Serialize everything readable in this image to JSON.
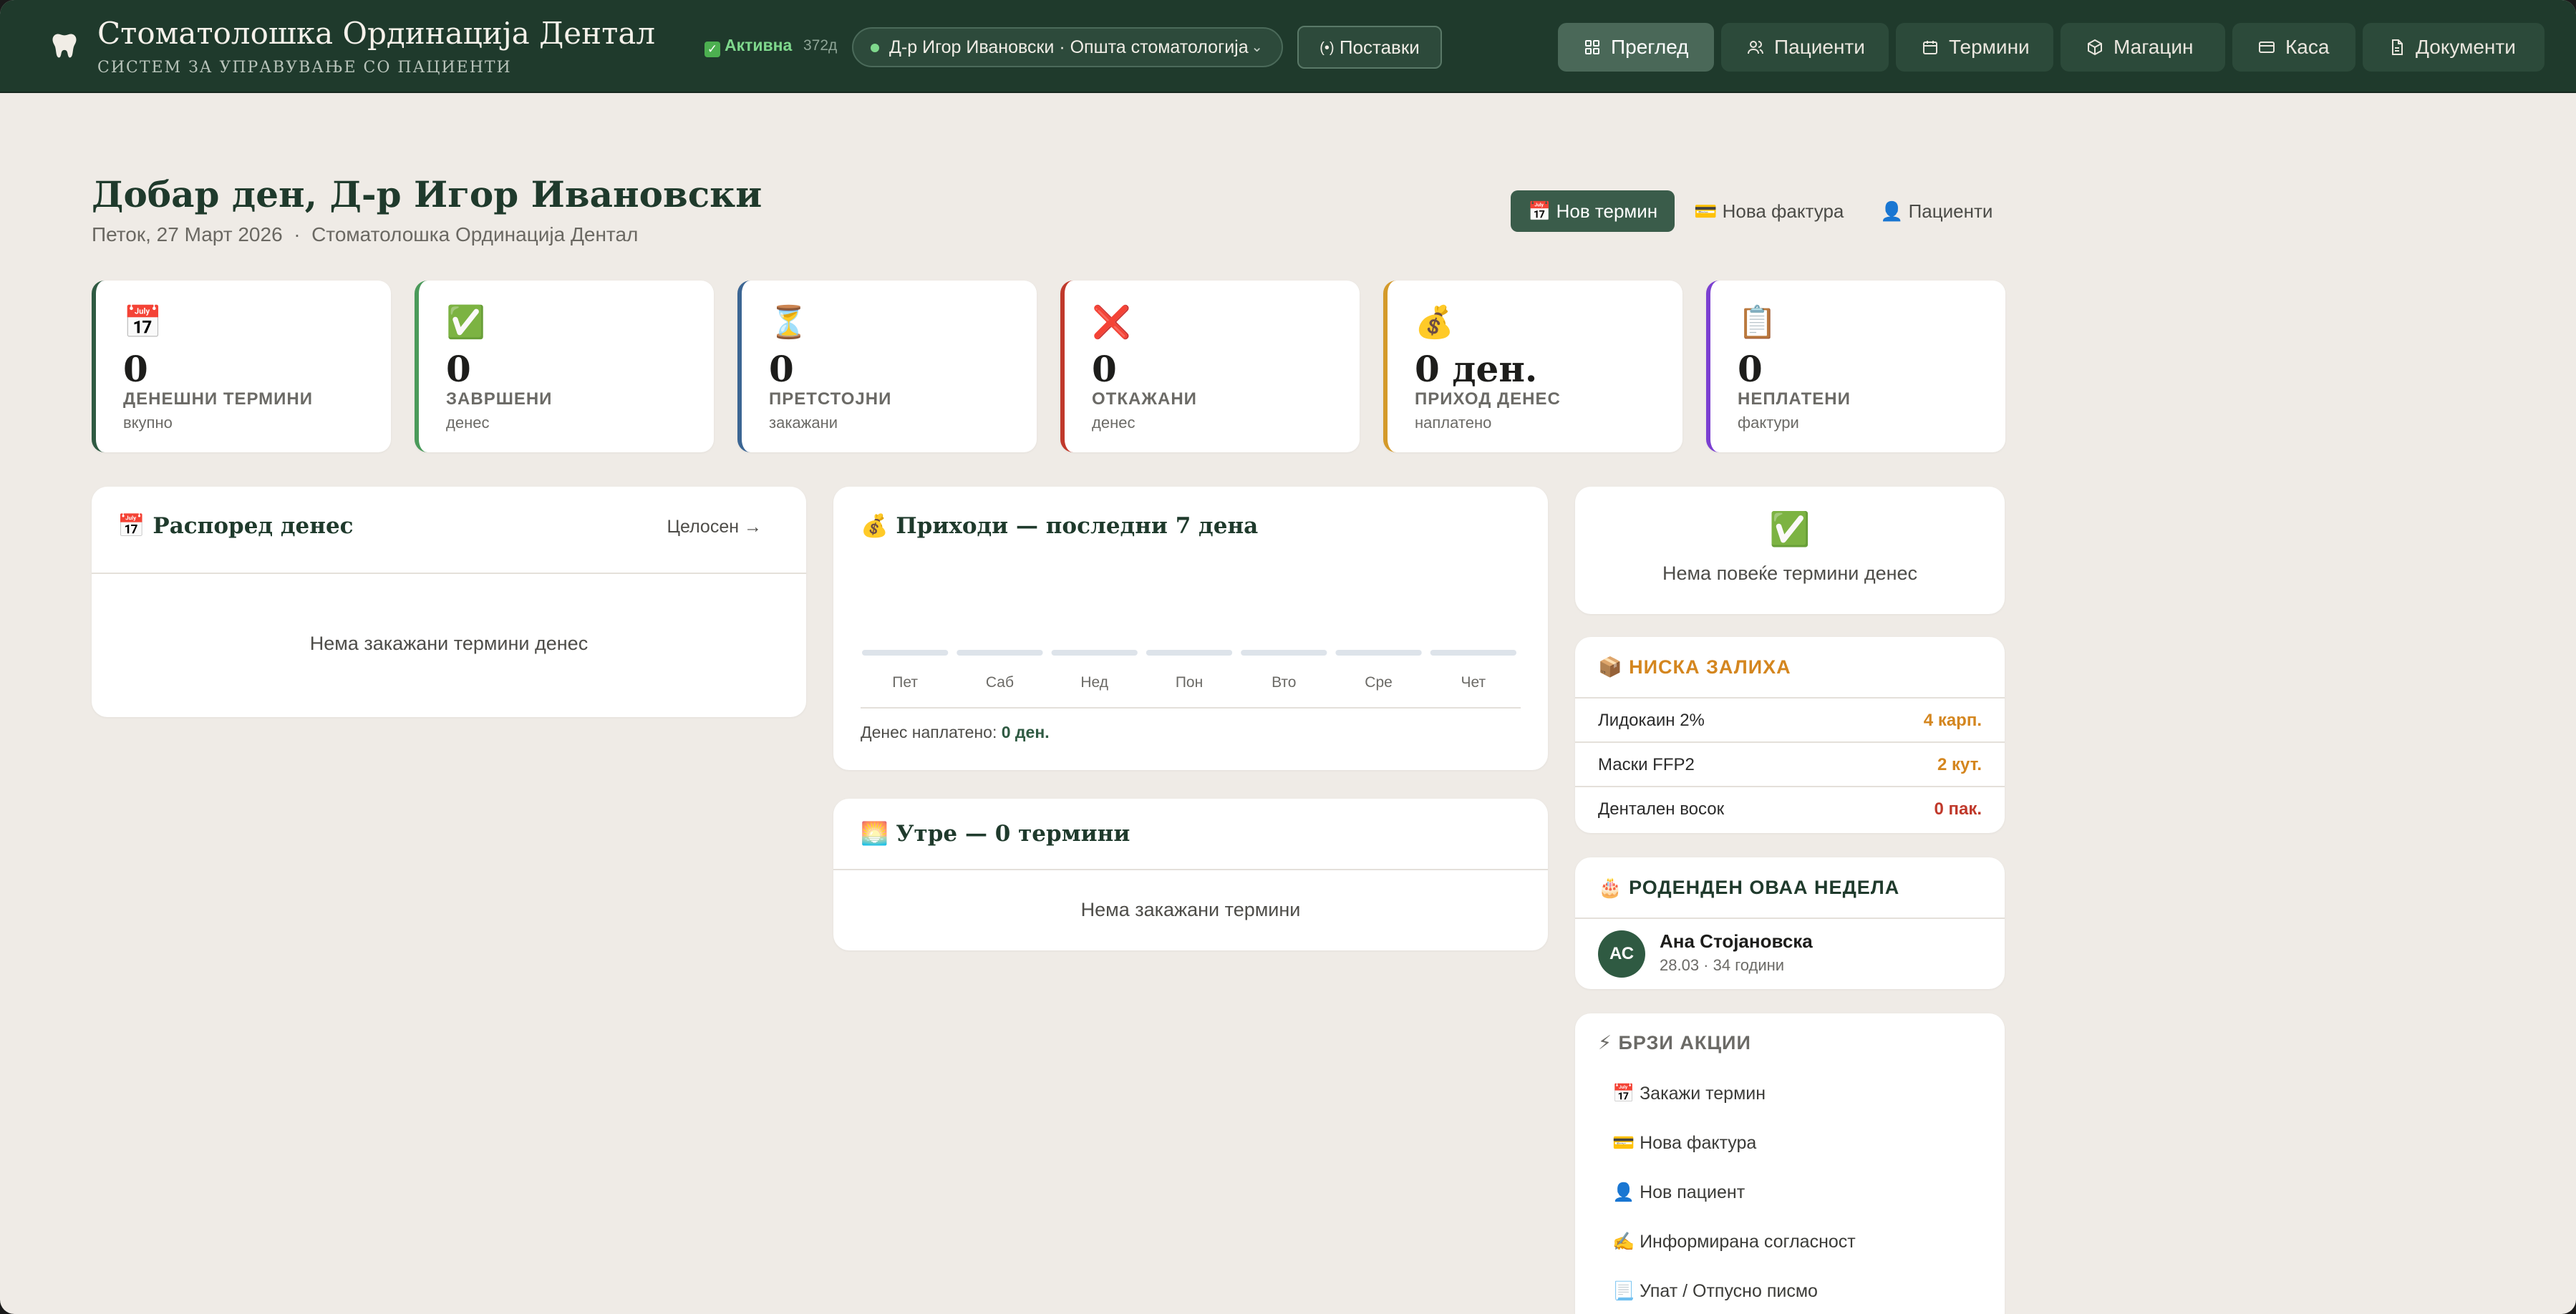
{
  "app": {
    "title": "Стоматолошка Ординација Дентал",
    "subtitle": "СИСТЕМ ЗА УПРАВУВАЊЕ СО ПАЦИЕНТИ",
    "status": "Активна",
    "days_left": "372д",
    "doctor_select": "Д-р Игор Ивановски · Општа стоматологија",
    "settings_label": "Поставки"
  },
  "nav": [
    {
      "label": "Преглед",
      "icon": "grid-icon",
      "active": true
    },
    {
      "label": "Пациенти",
      "icon": "users-icon"
    },
    {
      "label": "Термини",
      "icon": "calendar-icon"
    },
    {
      "label": "Магацин",
      "icon": "box-icon"
    },
    {
      "label": "Каса",
      "icon": "card-icon"
    },
    {
      "label": "Документи",
      "icon": "document-icon"
    }
  ],
  "header": {
    "greeting": "Добар ден, Д-р Игор Ивановски",
    "date_line": "Петок, 27 Март 2026  ·  Стоматолошка Ординација Дентал",
    "new_appointment": "📅 Нов термин",
    "new_invoice": "💳 Нова фактура",
    "patients": "👤 Пациенти"
  },
  "stats": [
    {
      "emoji": "📅",
      "value": "0",
      "label": "ДЕНЕШНИ ТЕРМИНИ",
      "sub": "вкупно",
      "color": "#2f5a42"
    },
    {
      "emoji": "✅",
      "value": "0",
      "label": "ЗАВРШЕНИ",
      "sub": "денес",
      "color": "#4a9a5a"
    },
    {
      "emoji": "⏳",
      "value": "0",
      "label": "ПРЕТСТОЈНИ",
      "sub": "закажани",
      "color": "#3b6593"
    },
    {
      "emoji": "❌",
      "value": "0",
      "label": "ОТКАЖАНИ",
      "sub": "денес",
      "color": "#c0392b"
    },
    {
      "emoji": "💰",
      "value": "0 ден.",
      "label": "ПРИХОД ДЕНЕС",
      "sub": "наплатено",
      "color": "#d49a2a"
    },
    {
      "emoji": "📋",
      "value": "0",
      "label": "НЕПЛАТЕНИ",
      "sub": "фактури",
      "color": "#7b3fd1"
    }
  ],
  "schedule": {
    "title": "📅 Распоред денес",
    "link": "Целосен →",
    "empty": "Нема закажани термини денес"
  },
  "revenue": {
    "title": "💰 Приходи — последни 7 дена",
    "paid_label": "Денес наплатено:",
    "paid_value": "0 ден."
  },
  "chart_data": {
    "type": "bar",
    "categories": [
      "Пет",
      "Саб",
      "Нед",
      "Пон",
      "Вто",
      "Сре",
      "Чет"
    ],
    "values": [
      0,
      0,
      0,
      0,
      0,
      0,
      0
    ],
    "title": "💰 Приходи — последни 7 дена",
    "grid": false
  },
  "tomorrow": {
    "title": "🌅 Утре — 0 термини",
    "empty": "Нема закажани термини"
  },
  "no_more": {
    "emoji": "✅",
    "text": "Нема повеќе термини денес"
  },
  "low_stock": {
    "title": "📦 НИСКА ЗАЛИХА",
    "items": [
      {
        "name": "Лидокаин 2%",
        "qty": "4 карп.",
        "color": "#d4861f"
      },
      {
        "name": "Маски FFP2",
        "qty": "2 кут.",
        "color": "#d4861f"
      },
      {
        "name": "Дентален восок",
        "qty": "0 пак.",
        "color": "#c0392b"
      }
    ]
  },
  "birthdays": {
    "title": "🎂 РОДЕНДЕН ОВАА НЕДЕЛА",
    "initials": "АС",
    "name": "Ана Стојановска",
    "detail": "28.03 · 34 години"
  },
  "quick_actions": {
    "title": "⚡ БРЗИ АКЦИИ",
    "items": [
      "📅 Закажи термин",
      "💳 Нова фактура",
      "👤 Нов пациент",
      "✍️ Информирана согласност",
      "📃 Упат / Отпусно писмо"
    ]
  }
}
